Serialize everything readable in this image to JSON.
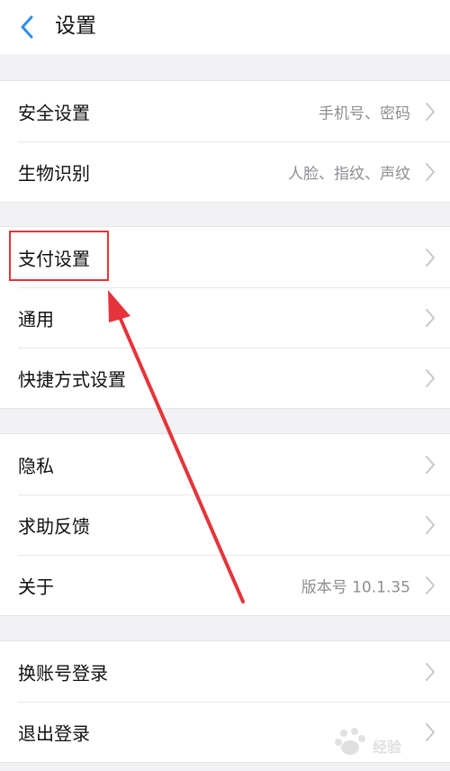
{
  "header": {
    "title": "设置"
  },
  "groups": [
    {
      "items": [
        {
          "label": "安全设置",
          "value": "手机号、密码"
        },
        {
          "label": "生物识别",
          "value": "人脸、指纹、声纹"
        }
      ]
    },
    {
      "items": [
        {
          "label": "支付设置",
          "value": ""
        },
        {
          "label": "通用",
          "value": ""
        },
        {
          "label": "快捷方式设置",
          "value": ""
        }
      ]
    },
    {
      "items": [
        {
          "label": "隐私",
          "value": ""
        },
        {
          "label": "求助反馈",
          "value": ""
        },
        {
          "label": "关于",
          "value": "版本号 10.1.35"
        }
      ]
    },
    {
      "items": [
        {
          "label": "换账号登录",
          "value": ""
        },
        {
          "label": "退出登录",
          "value": ""
        }
      ]
    }
  ],
  "colors": {
    "accent": "#2b8fe6",
    "annotation": "#e5343a",
    "background": "#f2f2f4"
  },
  "icons": {
    "back": "chevron-left-icon",
    "row": "chevron-right-icon"
  },
  "watermark": {
    "text": "经验"
  }
}
